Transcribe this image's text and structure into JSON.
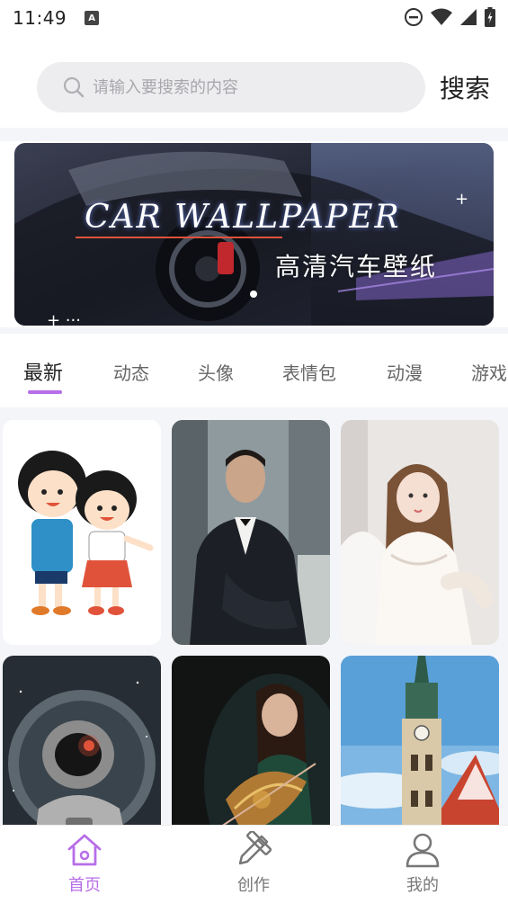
{
  "status_bar": {
    "time": "11:49",
    "notification_letter": "A"
  },
  "search": {
    "placeholder": "请输入要搜索的内容",
    "button_label": "搜索"
  },
  "banner": {
    "title": "CAR WALLPAPER",
    "subtitle": "高清汽车壁纸"
  },
  "tabs": [
    {
      "label": "最新",
      "active": true
    },
    {
      "label": "动态"
    },
    {
      "label": "头像"
    },
    {
      "label": "表情包"
    },
    {
      "label": "动漫"
    },
    {
      "label": "游戏"
    }
  ],
  "wallpapers": [
    {
      "subject": "cartoon-kids"
    },
    {
      "subject": "man-in-suit"
    },
    {
      "subject": "girl-in-white-dress"
    },
    {
      "subject": "astronaut"
    },
    {
      "subject": "girl-with-violin"
    },
    {
      "subject": "clock-tower"
    }
  ],
  "bottom_nav": {
    "home_label": "首页",
    "create_label": "创作",
    "mine_label": "我的",
    "active": "home"
  },
  "colors": {
    "accent": "#b76ee8",
    "search_bg": "#ededf0",
    "page_bg": "#f4f5f9"
  }
}
